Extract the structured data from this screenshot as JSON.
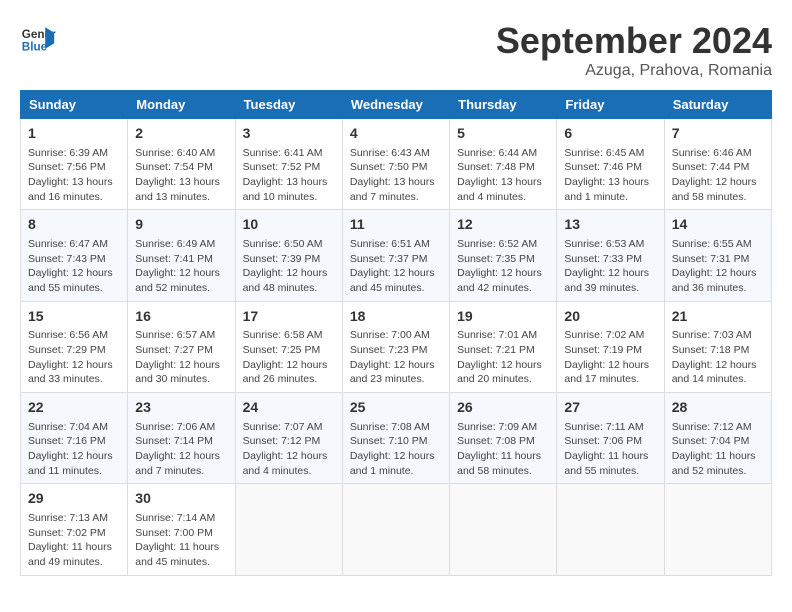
{
  "header": {
    "logo_line1": "General",
    "logo_line2": "Blue",
    "month_title": "September 2024",
    "subtitle": "Azuga, Prahova, Romania"
  },
  "weekdays": [
    "Sunday",
    "Monday",
    "Tuesday",
    "Wednesday",
    "Thursday",
    "Friday",
    "Saturday"
  ],
  "weeks": [
    [
      {
        "day": "1",
        "info": "Sunrise: 6:39 AM\nSunset: 7:56 PM\nDaylight: 13 hours\nand 16 minutes."
      },
      {
        "day": "2",
        "info": "Sunrise: 6:40 AM\nSunset: 7:54 PM\nDaylight: 13 hours\nand 13 minutes."
      },
      {
        "day": "3",
        "info": "Sunrise: 6:41 AM\nSunset: 7:52 PM\nDaylight: 13 hours\nand 10 minutes."
      },
      {
        "day": "4",
        "info": "Sunrise: 6:43 AM\nSunset: 7:50 PM\nDaylight: 13 hours\nand 7 minutes."
      },
      {
        "day": "5",
        "info": "Sunrise: 6:44 AM\nSunset: 7:48 PM\nDaylight: 13 hours\nand 4 minutes."
      },
      {
        "day": "6",
        "info": "Sunrise: 6:45 AM\nSunset: 7:46 PM\nDaylight: 13 hours\nand 1 minute."
      },
      {
        "day": "7",
        "info": "Sunrise: 6:46 AM\nSunset: 7:44 PM\nDaylight: 12 hours\nand 58 minutes."
      }
    ],
    [
      {
        "day": "8",
        "info": "Sunrise: 6:47 AM\nSunset: 7:43 PM\nDaylight: 12 hours\nand 55 minutes."
      },
      {
        "day": "9",
        "info": "Sunrise: 6:49 AM\nSunset: 7:41 PM\nDaylight: 12 hours\nand 52 minutes."
      },
      {
        "day": "10",
        "info": "Sunrise: 6:50 AM\nSunset: 7:39 PM\nDaylight: 12 hours\nand 48 minutes."
      },
      {
        "day": "11",
        "info": "Sunrise: 6:51 AM\nSunset: 7:37 PM\nDaylight: 12 hours\nand 45 minutes."
      },
      {
        "day": "12",
        "info": "Sunrise: 6:52 AM\nSunset: 7:35 PM\nDaylight: 12 hours\nand 42 minutes."
      },
      {
        "day": "13",
        "info": "Sunrise: 6:53 AM\nSunset: 7:33 PM\nDaylight: 12 hours\nand 39 minutes."
      },
      {
        "day": "14",
        "info": "Sunrise: 6:55 AM\nSunset: 7:31 PM\nDaylight: 12 hours\nand 36 minutes."
      }
    ],
    [
      {
        "day": "15",
        "info": "Sunrise: 6:56 AM\nSunset: 7:29 PM\nDaylight: 12 hours\nand 33 minutes."
      },
      {
        "day": "16",
        "info": "Sunrise: 6:57 AM\nSunset: 7:27 PM\nDaylight: 12 hours\nand 30 minutes."
      },
      {
        "day": "17",
        "info": "Sunrise: 6:58 AM\nSunset: 7:25 PM\nDaylight: 12 hours\nand 26 minutes."
      },
      {
        "day": "18",
        "info": "Sunrise: 7:00 AM\nSunset: 7:23 PM\nDaylight: 12 hours\nand 23 minutes."
      },
      {
        "day": "19",
        "info": "Sunrise: 7:01 AM\nSunset: 7:21 PM\nDaylight: 12 hours\nand 20 minutes."
      },
      {
        "day": "20",
        "info": "Sunrise: 7:02 AM\nSunset: 7:19 PM\nDaylight: 12 hours\nand 17 minutes."
      },
      {
        "day": "21",
        "info": "Sunrise: 7:03 AM\nSunset: 7:18 PM\nDaylight: 12 hours\nand 14 minutes."
      }
    ],
    [
      {
        "day": "22",
        "info": "Sunrise: 7:04 AM\nSunset: 7:16 PM\nDaylight: 12 hours\nand 11 minutes."
      },
      {
        "day": "23",
        "info": "Sunrise: 7:06 AM\nSunset: 7:14 PM\nDaylight: 12 hours\nand 7 minutes."
      },
      {
        "day": "24",
        "info": "Sunrise: 7:07 AM\nSunset: 7:12 PM\nDaylight: 12 hours\nand 4 minutes."
      },
      {
        "day": "25",
        "info": "Sunrise: 7:08 AM\nSunset: 7:10 PM\nDaylight: 12 hours\nand 1 minute."
      },
      {
        "day": "26",
        "info": "Sunrise: 7:09 AM\nSunset: 7:08 PM\nDaylight: 11 hours\nand 58 minutes."
      },
      {
        "day": "27",
        "info": "Sunrise: 7:11 AM\nSunset: 7:06 PM\nDaylight: 11 hours\nand 55 minutes."
      },
      {
        "day": "28",
        "info": "Sunrise: 7:12 AM\nSunset: 7:04 PM\nDaylight: 11 hours\nand 52 minutes."
      }
    ],
    [
      {
        "day": "29",
        "info": "Sunrise: 7:13 AM\nSunset: 7:02 PM\nDaylight: 11 hours\nand 49 minutes."
      },
      {
        "day": "30",
        "info": "Sunrise: 7:14 AM\nSunset: 7:00 PM\nDaylight: 11 hours\nand 45 minutes."
      },
      {
        "day": "",
        "info": ""
      },
      {
        "day": "",
        "info": ""
      },
      {
        "day": "",
        "info": ""
      },
      {
        "day": "",
        "info": ""
      },
      {
        "day": "",
        "info": ""
      }
    ]
  ]
}
